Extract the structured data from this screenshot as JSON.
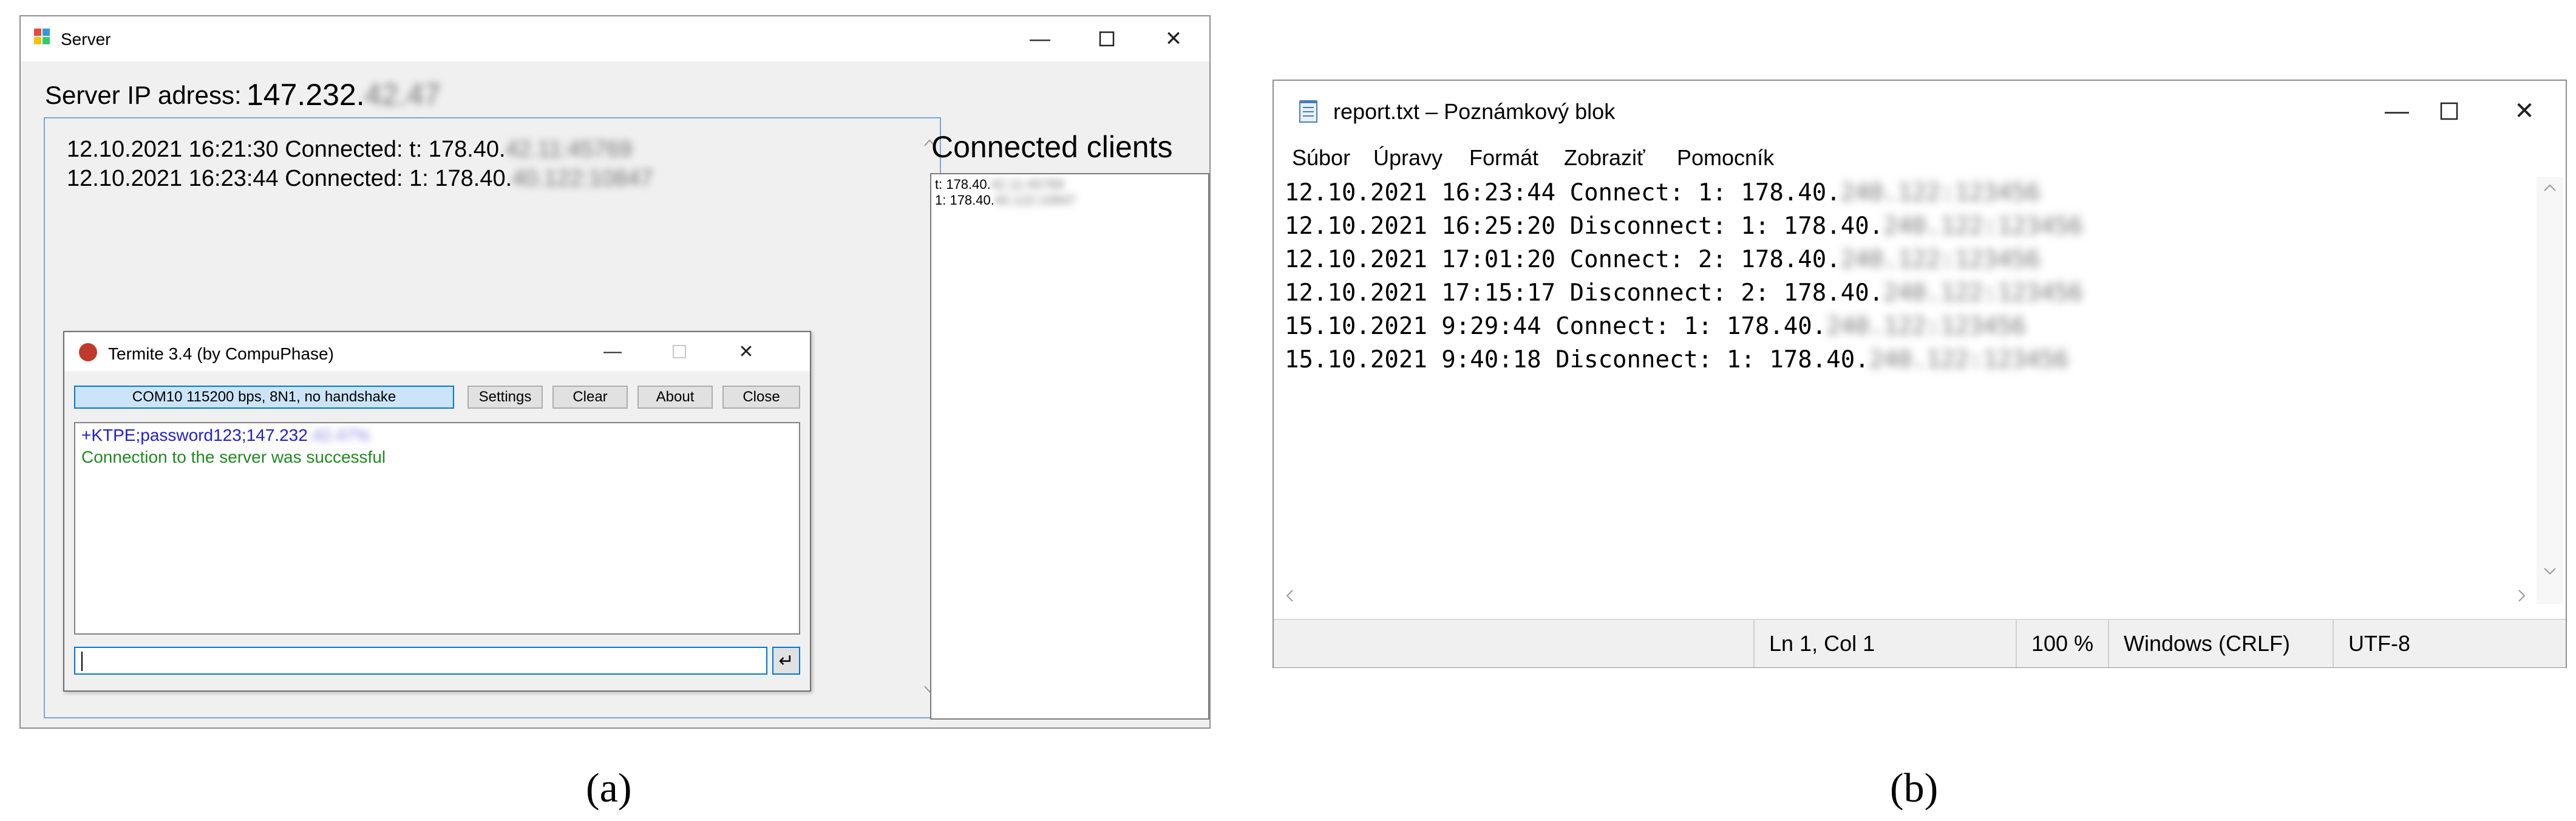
{
  "server_window": {
    "title": "Server",
    "ip_label": "Server IP adress:",
    "ip_value": "147.232.",
    "ip_blurred": "42.47",
    "log": [
      {
        "text": "12.10.2021 16:21:30 Connected: t: 178.40.",
        "blurred": "42.11:45769"
      },
      {
        "text": "12.10.2021 16:23:44 Connected: 1: 178.40.",
        "blurred": "40.122:10847"
      }
    ],
    "clients_title": "Connected clients",
    "clients": [
      {
        "text": "t: 178.40.",
        "blurred": "42.11:45769"
      },
      {
        "text": "1: 178.40.",
        "blurred": "40.122:10847"
      }
    ]
  },
  "termite": {
    "title": "Termite 3.4 (by CompuPhase)",
    "status": "COM10 115200 bps, 8N1, no handshake",
    "buttons": {
      "settings": "Settings",
      "clear": "Clear",
      "about": "About",
      "close": "Close"
    },
    "output": [
      {
        "text": "+KTPE;password123;147.232",
        "blurred": ".42.47%",
        "color": "#2020d0"
      },
      {
        "text": "Connection to the server was successful",
        "color": "#1e8a1e"
      }
    ],
    "send_glyph": "↵"
  },
  "notepad": {
    "title": "report.txt – Poznámkový blok",
    "menu": [
      "Súbor",
      "Úpravy",
      "Formát",
      "Zobraziť",
      "Pomocník"
    ],
    "lines": [
      {
        "text": "12.10.2021 16:23:44 Connect: 1:  178.40.",
        "blurred": "240.122:123456"
      },
      {
        "text": "12.10.2021 16:25:20 Disconnect: 1:  178.40.",
        "blurred": "240.122:123456"
      },
      {
        "text": "12.10.2021 17:01:20 Connect: 2:  178.40.",
        "blurred": "240.122:123456"
      },
      {
        "text": "12.10.2021 17:15:17 Disconnect: 2:  178.40.",
        "blurred": "240.122:123456"
      },
      {
        "text": "15.10.2021 9:29:44 Connect: 1:  178.40.",
        "blurred": "240.122:123456"
      },
      {
        "text": "15.10.2021 9:40:18 Disconnect: 1:  178.40.",
        "blurred": "240.122:123456"
      }
    ],
    "status": {
      "position": "Ln 1, Col 1",
      "zoom": "100 %",
      "eol": "Windows (CRLF)",
      "encoding": "UTF-8"
    }
  },
  "captions": {
    "a": "(a)",
    "b": "(b)"
  }
}
